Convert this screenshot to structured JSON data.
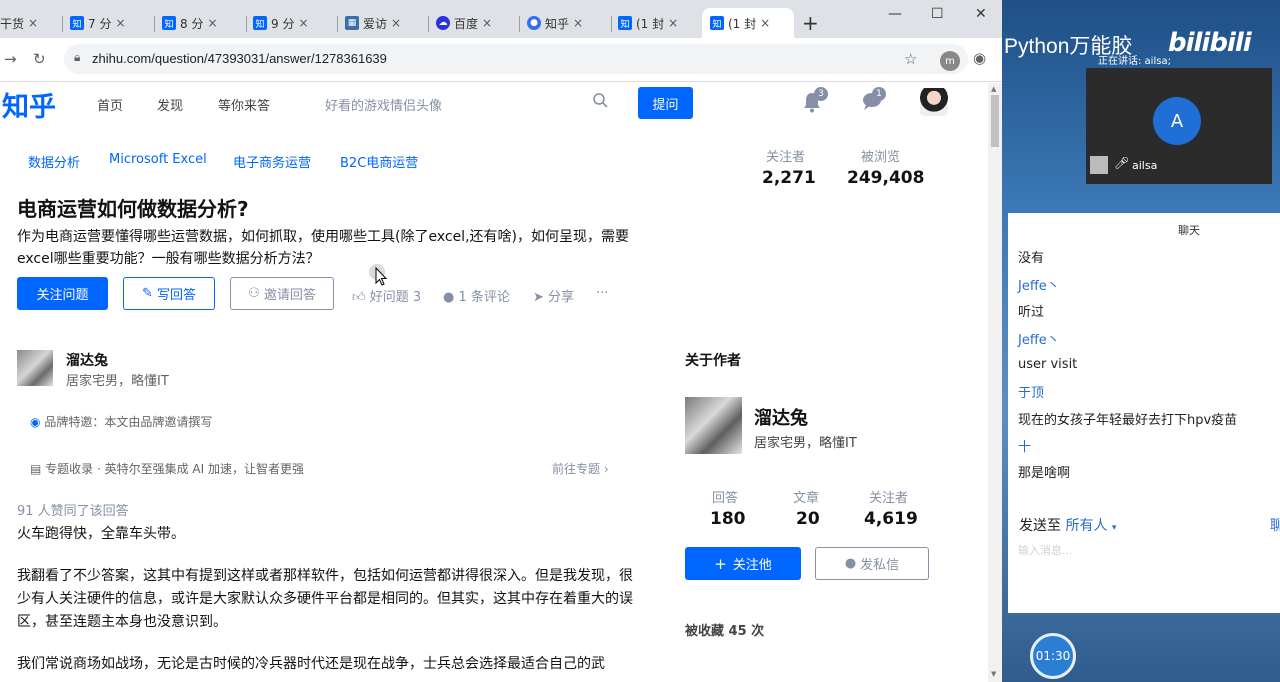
{
  "browser": {
    "tabs": [
      {
        "label": "干货",
        "favicon": "none"
      },
      {
        "label": "7 分",
        "favicon": "zh"
      },
      {
        "label": "8 分",
        "favicon": "zh"
      },
      {
        "label": "9 分",
        "favicon": "zh"
      },
      {
        "label": "爱访",
        "favicon": "chart"
      },
      {
        "label": "百度",
        "favicon": "baidu"
      },
      {
        "label": "知乎",
        "favicon": "paw"
      },
      {
        "label": "(1 封",
        "favicon": "zh"
      },
      {
        "label": "(1 封",
        "favicon": "zh"
      }
    ],
    "favicon_text": "知",
    "new_tab": "+",
    "url": "zhihu.com/question/47393031/answer/1278361639",
    "profile_initial": "m"
  },
  "zhihu": {
    "logo": "知乎",
    "nav": [
      "首页",
      "发现",
      "等你来答"
    ],
    "search_text": "好看的游戏情侣头像",
    "ask_button": "提问",
    "notification_count": "3",
    "message_count": "1"
  },
  "question": {
    "topics": [
      "数据分析",
      "Microsoft Excel",
      "电子商务运营",
      "B2C电商运营"
    ],
    "followers_label": "关注者",
    "followers": "2,271",
    "views_label": "被浏览",
    "views": "249,408",
    "title": "电商运营如何做数据分析?",
    "detail": "作为电商运营要懂得哪些运营数据，如何抓取，使用哪些工具(除了excel,还有啥)，如何呈现，需要excel哪些重要功能？一般有哪些数据分析方法？",
    "follow_button": "关注问题",
    "write_button": "写回答",
    "invite_button": "邀请回答",
    "good_question": "好问题 3",
    "comments": "1 条评论",
    "share": "分享",
    "more": "···"
  },
  "answer": {
    "author_name": "溜达兔",
    "author_bio": "居家宅男，略懂IT",
    "brand_line": "品牌特邀：本文由品牌邀请撰写",
    "special_line": "专题收录 · 英特尔至强集成 AI 加速，让智者更强",
    "special_goto": "前往专题",
    "upvote_count": "91 人赞同了该回答",
    "paragraphs": [
      "火车跑得快，全靠车头带。",
      "我翻看了不少答案，这其中有提到这样或者那样软件，包括如何运营都讲得很深入。但是我发现，很少有人关注硬件的信息，或许是大家默认众多硬件平台都是相同的。但其实，这其中存在着重大的误区，甚至连题主本身也没意识到。",
      "我们常说商场如战场，无论是古时候的冷兵器时代还是现在战争，士兵总会选择最适合自己的武"
    ]
  },
  "author_card": {
    "title": "关于作者",
    "name": "溜达兔",
    "bio": "居家宅男，略懂IT",
    "answers_label": "回答",
    "answers": "180",
    "articles_label": "文章",
    "articles": "20",
    "followers_label": "关注者",
    "followers": "4,619",
    "follow_button": "关注他",
    "message_button": "发私信",
    "collected": "被收藏 45 次"
  },
  "overlay": {
    "watermark": "Python万能胶",
    "bilibili": "bilibili",
    "speaking": "正在讲话: ailsa;",
    "video_initial": "A",
    "video_name": "ailsa",
    "chat_title": "聊天",
    "chat_lines": [
      {
        "text": "没有",
        "is_name": false
      },
      {
        "text": "Jeffe丶",
        "is_name": true
      },
      {
        "text": "听过",
        "is_name": false
      },
      {
        "text": "Jeffe丶",
        "is_name": true
      },
      {
        "text": "user visit",
        "is_name": false
      },
      {
        "text": "于顶",
        "is_name": true
      },
      {
        "text": "现在的女孩子年轻最好去打下hpv疫苗",
        "is_name": false
      },
      {
        "text": "十",
        "is_name": true
      },
      {
        "text": "那是啥啊",
        "is_name": false
      }
    ],
    "send_to_label": "发送至",
    "send_to_target": "所有人",
    "chat_input_hint": "输入消息...",
    "edge_text": "聊",
    "timer": "01:30"
  },
  "colors": {
    "zhihu_blue": "#0066ff",
    "muted": "#8590a6",
    "chat_name": "#2a6bd1"
  }
}
